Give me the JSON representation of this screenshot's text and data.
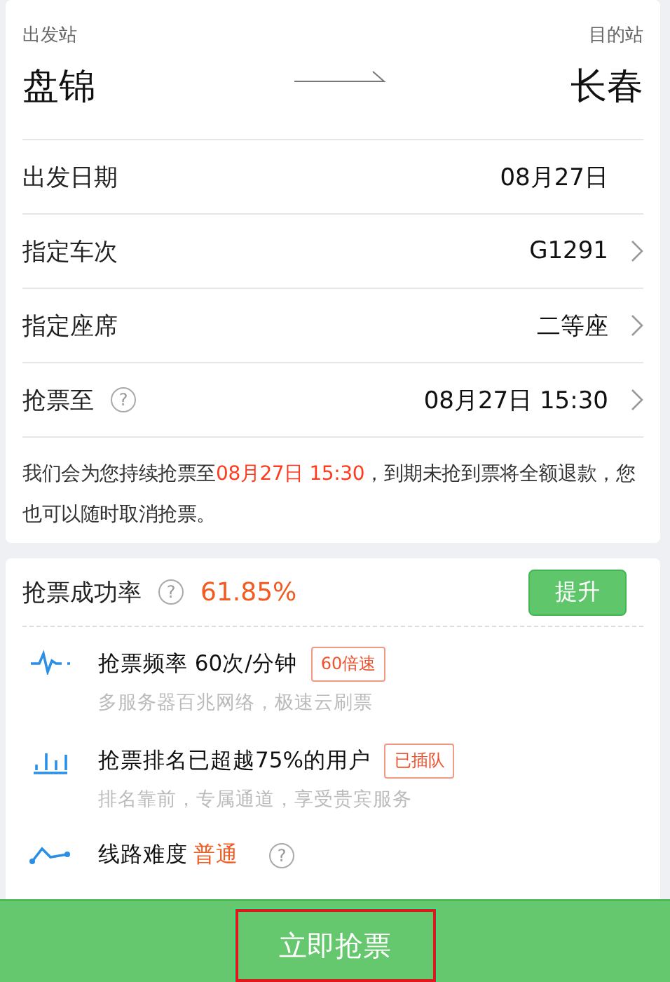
{
  "route": {
    "from_label": "出发站",
    "from": "盘锦",
    "to_label": "目的站",
    "to": "长春"
  },
  "fields": [
    {
      "label": "出发日期",
      "value": "08月27日",
      "chevron": false
    },
    {
      "label": "指定车次",
      "value": "G1291",
      "chevron": true
    },
    {
      "label": "指定座席",
      "value": "二等座",
      "chevron": true
    },
    {
      "label": "抢票至",
      "help": "?",
      "value": "08月27日 15:30",
      "chevron": true
    }
  ],
  "notice_parts": [
    "我们会为您持续抢票至",
    "08月27日 15:30",
    "，到期未抢到票将全额退款，您也可以随时取消抢票。"
  ],
  "success": {
    "label": "抢票成功率",
    "help": "?",
    "rate": "61.85%",
    "button": "提升"
  },
  "features": [
    {
      "kind": "pulse",
      "title": "抢票频率 60次/分钟",
      "badge": "60倍速",
      "desc": "多服务器百兆网络，极速云刷票"
    },
    {
      "kind": "bars",
      "title": "抢票排名已超越75%的用户",
      "badge": "已插队",
      "desc": "排名靠前，专属通道，享受贵宾服务"
    },
    {
      "kind": "route",
      "title": "线路难度",
      "level_text": "普通",
      "help": "?"
    }
  ],
  "submit": "立即抢票"
}
